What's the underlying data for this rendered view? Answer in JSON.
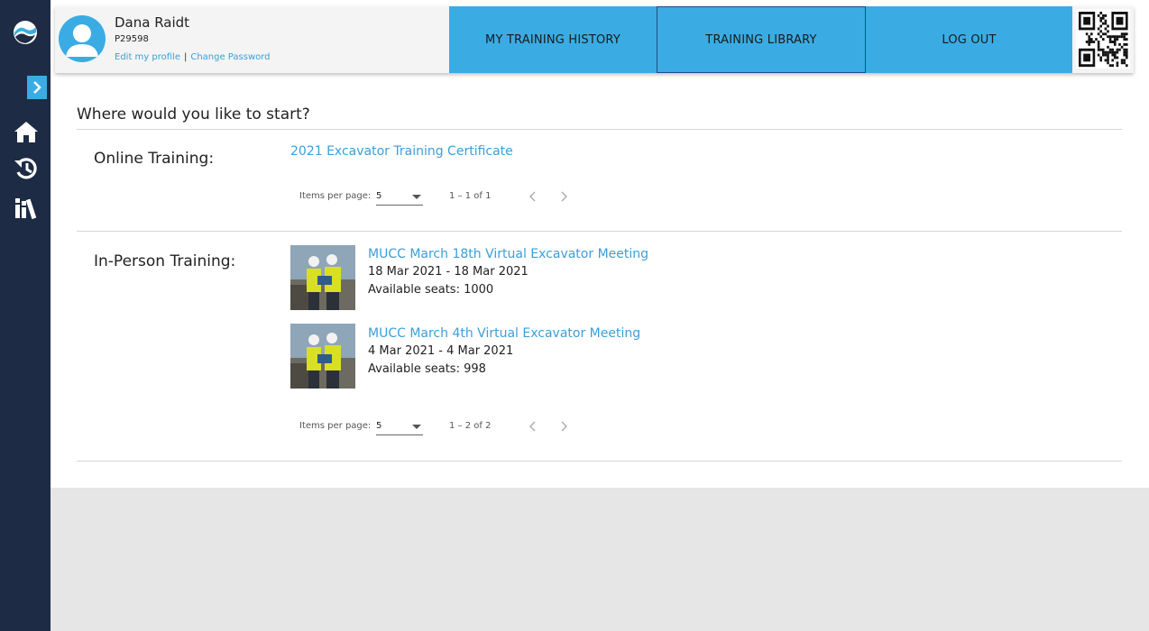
{
  "user": {
    "name": "Dana Raidt",
    "id": "P29598",
    "edit_profile": "Edit my profile",
    "separator": "|",
    "change_password": "Change Password"
  },
  "nav": {
    "history": "MY TRAINING HISTORY",
    "library": "TRAINING LIBRARY",
    "logout": "LOG OUT"
  },
  "main": {
    "title": "Where would you like to start?",
    "online": {
      "label": "Online Training:",
      "course": "2021 Excavator Training Certificate",
      "pager": {
        "items_label": "Items per page:",
        "per_page": "5",
        "range": "1 – 1 of 1"
      }
    },
    "inperson": {
      "label": "In-Person Training:",
      "events": [
        {
          "title": "MUCC March 18th Virtual Excavator Meeting",
          "dates": "18 Mar 2021 - 18 Mar 2021",
          "seats": "Available seats: 1000"
        },
        {
          "title": "MUCC March 4th Virtual Excavator Meeting",
          "dates": "4 Mar 2021 - 4 Mar 2021",
          "seats": "Available seats: 998"
        }
      ],
      "pager": {
        "items_label": "Items per page:",
        "per_page": "5",
        "range": "1 – 2 of 2"
      }
    }
  },
  "colors": {
    "sidebar": "#1d2b45",
    "accent": "#3aace3",
    "link": "#3a9fd9"
  }
}
